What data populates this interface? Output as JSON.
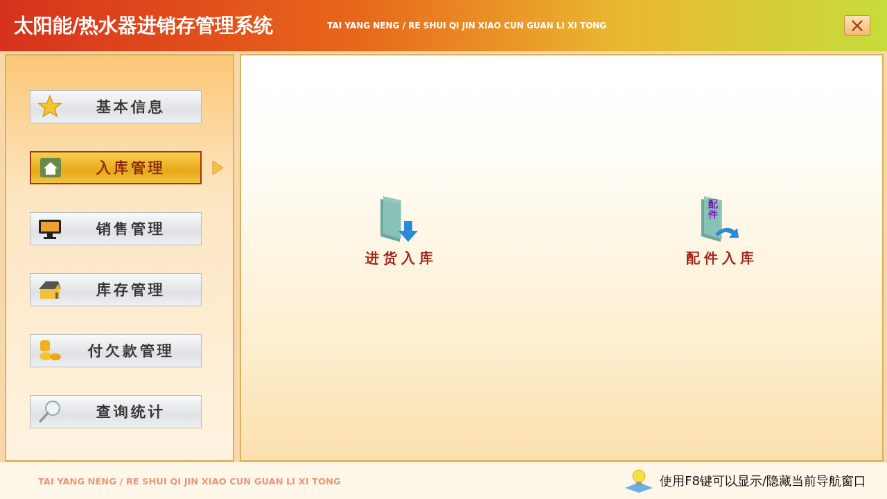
{
  "window": {
    "title": "太阳能/热水器进销存管理系统",
    "subtitle": "TAI YANG NENG / RE SHUI QI JIN XIAO CUN GUAN LI XI TONG",
    "close": "×"
  },
  "sidebar": {
    "items": [
      {
        "label": "基本信息",
        "kind": "star",
        "selected": false
      },
      {
        "label": "入库管理",
        "kind": "home",
        "selected": true
      },
      {
        "label": "销售管理",
        "kind": "monitor",
        "selected": false
      },
      {
        "label": "库存管理",
        "kind": "house",
        "selected": false
      },
      {
        "label": "付欠款管理",
        "kind": "coins",
        "selected": false
      },
      {
        "label": "查询统计",
        "kind": "magnifier",
        "selected": false
      }
    ]
  },
  "main": {
    "actions": [
      {
        "label": "进货入库",
        "kind": "download"
      },
      {
        "label": "配件入库",
        "kind": "parts",
        "icon_text": "配件"
      }
    ]
  },
  "status_bar": {
    "brand": "TAI YANG NENG / RE SHUI QI JIN XIAO CUN GUAN LI XI TONG",
    "hint": "使用F8键可以显示/隐藏当前导航窗口"
  }
}
